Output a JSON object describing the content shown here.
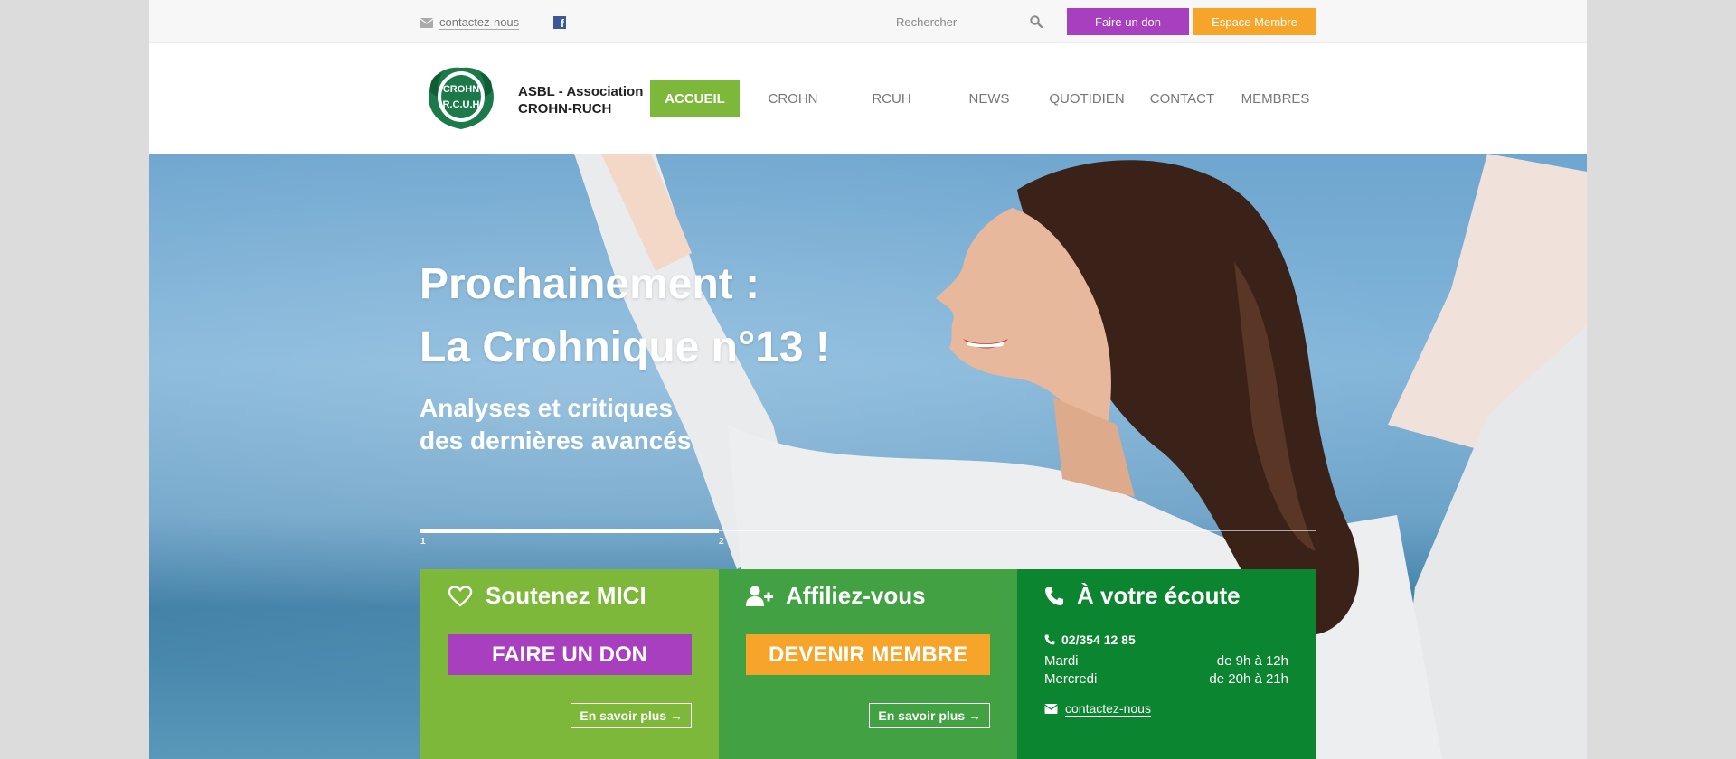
{
  "topbar": {
    "contact_label": "contactez-nous",
    "facebook_label": "f",
    "search_placeholder": "Rechercher",
    "don_button": "Faire un don",
    "membre_button": "Espace Membre"
  },
  "header": {
    "org_line1": "ASBL - Association",
    "org_line2": "CROHN-RUCH",
    "nav": [
      {
        "label": "ACCUEIL",
        "active": true
      },
      {
        "label": "CROHN"
      },
      {
        "label": "RCUH"
      },
      {
        "label": "NEWS"
      },
      {
        "label": "QUOTIDIEN"
      },
      {
        "label": "CONTACT"
      },
      {
        "label": "MEMBRES"
      }
    ]
  },
  "hero": {
    "title_line1": "Prochainement :",
    "title_line2": "La Crohnique n°13 !",
    "subtitle_line1": "Analyses et critiques",
    "subtitle_line2": "des dernières avancés",
    "slides": [
      "1",
      "2"
    ]
  },
  "boxes": {
    "soutenez": {
      "title": "Soutenez MICI",
      "button": "FAIRE UN DON",
      "more": "En savoir plus →"
    },
    "affiliez": {
      "title": "Affiliez-vous",
      "button": "DEVENIR MEMBRE",
      "more": "En savoir plus →"
    },
    "ecoute": {
      "title": "À votre écoute",
      "phone": "02/354 12 85",
      "hours": [
        {
          "day": "Mardi",
          "time": "de 9h à 12h"
        },
        {
          "day": "Mercredi",
          "time": "de 20h à 21h"
        }
      ],
      "contact_label": "contactez-nous"
    }
  },
  "colors": {
    "green_light": "#7db83a",
    "green_mid": "#42a142",
    "green_dark": "#0b8530",
    "purple": "#a73fbe",
    "orange": "#f6a52a"
  },
  "icons": [
    "envelope-icon",
    "facebook-icon",
    "search-icon",
    "heart-icon",
    "user-plus-icon",
    "phone-icon"
  ]
}
